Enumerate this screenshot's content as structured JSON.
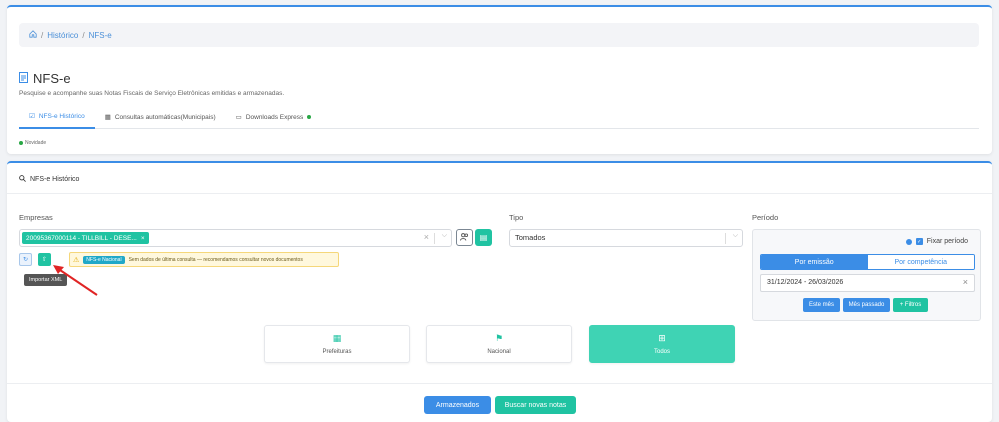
{
  "breadcrumb": {
    "home_icon": "home-icon",
    "items": [
      "Histórico",
      "NFS-e"
    ]
  },
  "header": {
    "title": "NFS-e",
    "subtitle": "Pesquise e acompanhe suas Notas Fiscais de Serviço Eletrônicas emitidas e armazenadas.",
    "tabs": [
      {
        "label": "NFS-e Histórico",
        "active": true
      },
      {
        "label": "Consultas automáticas(Municipais)"
      },
      {
        "label": "Downloads Express"
      }
    ],
    "novidade": "Novidade"
  },
  "panel": {
    "title": "NFS-e Histórico",
    "empresas_label": "Empresas",
    "empresa_chip": "20095367000114 - TILLBILL - DESE...",
    "tipo_label": "Tipo",
    "tipo_value": "Tomados",
    "alert_badge": "NFS-e Nacional",
    "alert_text": "Sem dados de última consulta — recomendamos consultar novos documentos",
    "tooltip": "Importar XML",
    "periodo_label": "Período",
    "fixar_label": "Fixar período",
    "seg_emissao": "Por emissão",
    "seg_competencia": "Por competência",
    "date_range": "31/12/2024 - 26/03/2026",
    "btn_este_mes": "Este mês",
    "btn_mes_passado": "Mês passado",
    "btn_filtros": "+ Filtros",
    "sources": [
      {
        "label": "Prefeituras"
      },
      {
        "label": "Nacional"
      },
      {
        "label": "Todos",
        "active": true
      }
    ],
    "btn_armazenados": "Armazenados",
    "btn_buscar": "Buscar novas notas"
  },
  "colors": {
    "primary": "#3b8de6",
    "accent": "#20c3a2",
    "warning_bg": "#fff8dd"
  }
}
